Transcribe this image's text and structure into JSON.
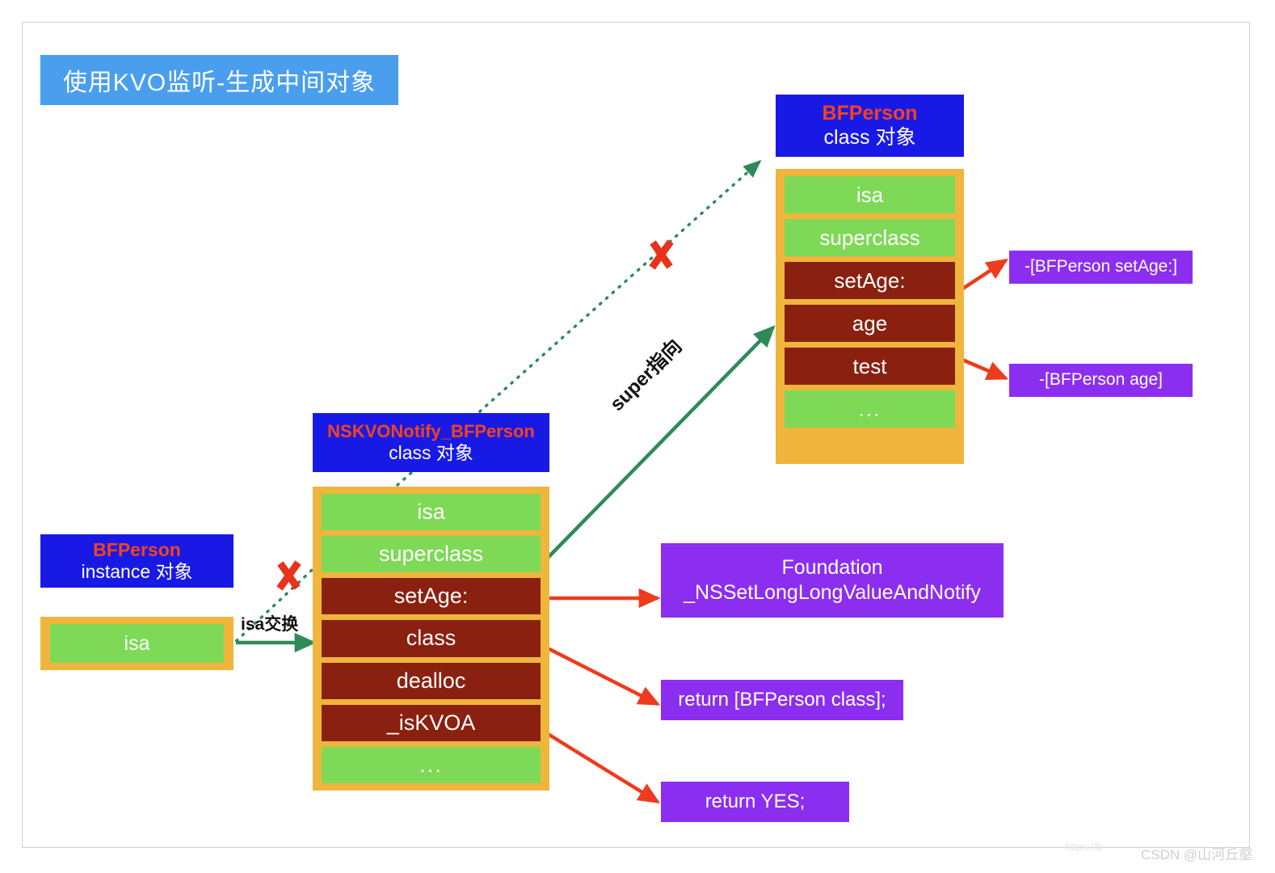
{
  "title": {
    "text": "使用KVO监听-生成中间对象"
  },
  "bfperson_class": {
    "header": {
      "name": "BFPerson",
      "kind": "class 对象"
    },
    "rows": [
      {
        "label": "isa",
        "style": "green"
      },
      {
        "label": "superclass",
        "style": "green"
      },
      {
        "label": "setAge:",
        "style": "dark"
      },
      {
        "label": "age",
        "style": "dark"
      },
      {
        "label": "test",
        "style": "dark"
      },
      {
        "label": "...",
        "style": "green"
      }
    ]
  },
  "nskvo_class": {
    "header": {
      "name": "NSKVONotify_BFPerson",
      "kind": "class 对象"
    },
    "rows": [
      {
        "label": "isa",
        "style": "green"
      },
      {
        "label": "superclass",
        "style": "green"
      },
      {
        "label": "setAge:",
        "style": "dark"
      },
      {
        "label": "class",
        "style": "dark"
      },
      {
        "label": "dealloc",
        "style": "dark"
      },
      {
        "label": "_isKVOA",
        "style": "dark"
      },
      {
        "label": "...",
        "style": "green"
      }
    ]
  },
  "bfperson_instance": {
    "header": {
      "name": "BFPerson",
      "kind": "instance 对象"
    },
    "rows": [
      {
        "label": "isa",
        "style": "green"
      }
    ]
  },
  "callouts": {
    "setage_impl": "-[BFPerson setAge:]",
    "age_impl": "-[BFPerson age]",
    "foundation_line1": "Foundation",
    "foundation_line2": "_NSSetLongLongValueAndNotify",
    "return_class": "return [BFPerson class];",
    "return_yes": "return YES;"
  },
  "annotations": {
    "isa_swap": "isa交换",
    "super_pointer": "super指向"
  },
  "watermark": {
    "url": "https://b",
    "credit": "CSDN @山河丘壑"
  },
  "colors": {
    "title_banner": "#4A9EEE",
    "blue_box": "#1919E6",
    "class_name_red": "#F4431C",
    "struct_border": "#EFB53C",
    "cell_green": "#7ED957",
    "cell_dark_red": "#8A2110",
    "purple": "#8B2EF0",
    "arrow_red": "#EE3B1E",
    "arrow_green": "#2E8B57",
    "dotted_green": "#2E8B57",
    "x_mark_red": "#E8321B"
  }
}
